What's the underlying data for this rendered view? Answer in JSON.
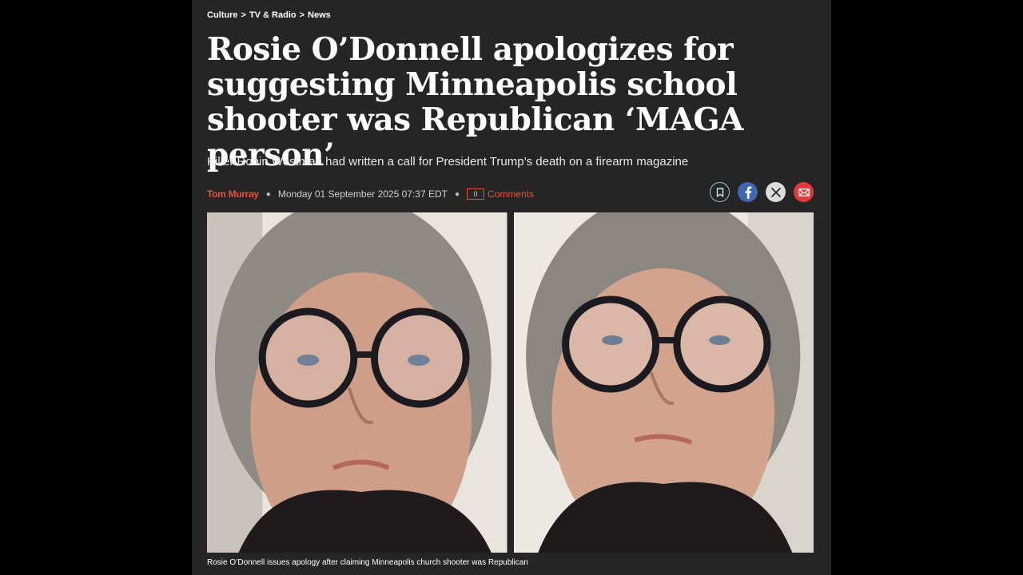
{
  "breadcrumb": {
    "items": [
      "Culture",
      "TV & Radio",
      "News"
    ],
    "separator": ">"
  },
  "headline": "Rosie O’Donnell apologizes for suggesting Minneapolis school shooter was Republican ‘MAGA person’",
  "subheadline": "Killer Robin Westman had written a call for President Trump’s death on a firearm magazine",
  "byline": {
    "author": "Tom Murray",
    "date": "Monday 01 September 2025 07:37 EDT",
    "comment_count": "0",
    "comments_label": "Comments"
  },
  "share": {
    "icons": [
      "bookmark-icon",
      "facebook-icon",
      "x-icon",
      "email-icon"
    ]
  },
  "caption": "Rosie O’Donnell issues apology after claiming Minneapolis church shooter was Republican",
  "colors": {
    "background": "#252525",
    "accent": "#e0533f",
    "facebook": "#4267b2",
    "email": "#e23a3a"
  }
}
